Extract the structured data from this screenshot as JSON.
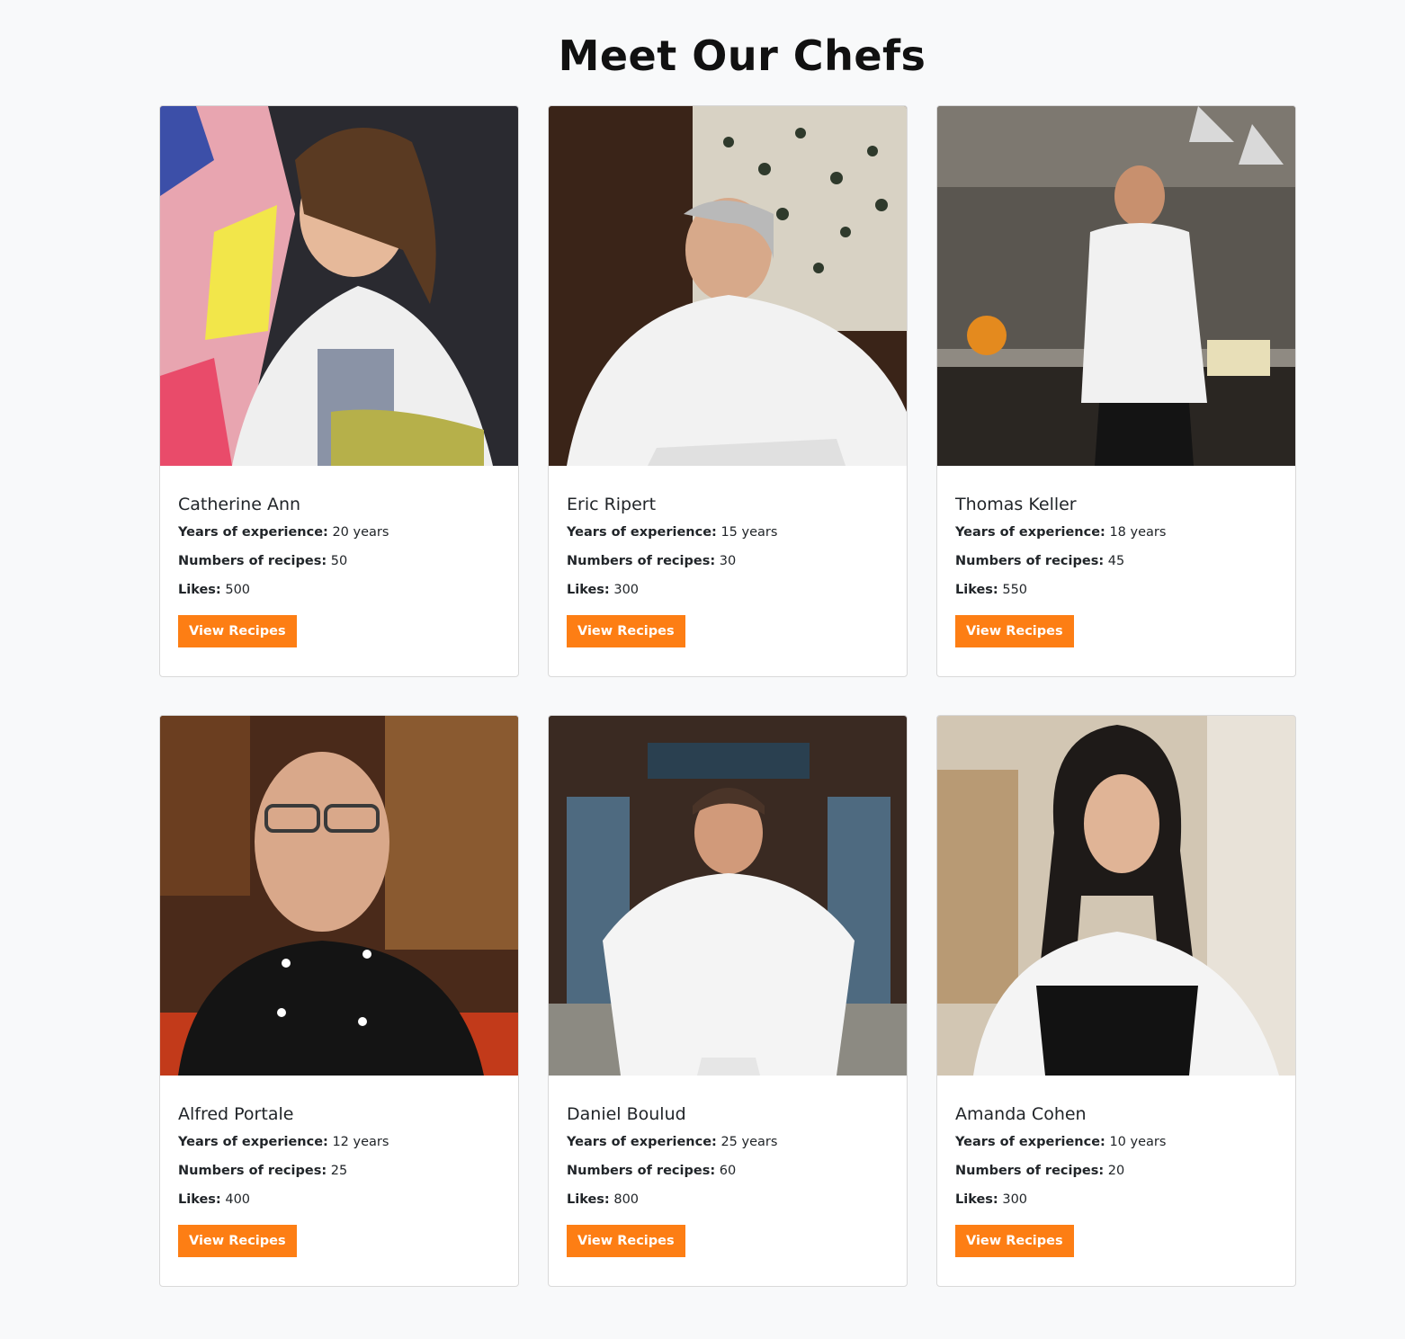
{
  "page": {
    "title": "Meet Our Chefs"
  },
  "labels": {
    "experience": "Years of experience:",
    "recipes": "Numbers of recipes:",
    "likes": "Likes:",
    "button": "View Recipes"
  },
  "colors": {
    "accent": "#fd7e14",
    "background": "#f8f9fa",
    "card": "#ffffff"
  },
  "chefs": [
    {
      "name": "Catherine Ann",
      "experience": "20 years",
      "recipes": "50",
      "likes": "500",
      "photo_icon": "chef-portrait-photo"
    },
    {
      "name": "Eric Ripert",
      "experience": "15 years",
      "recipes": "30",
      "likes": "300",
      "photo_icon": "chef-portrait-photo"
    },
    {
      "name": "Thomas Keller",
      "experience": "18 years",
      "recipes": "45",
      "likes": "550",
      "photo_icon": "chef-portrait-photo"
    },
    {
      "name": "Alfred Portale",
      "experience": "12 years",
      "recipes": "25",
      "likes": "400",
      "photo_icon": "chef-portrait-photo"
    },
    {
      "name": "Daniel Boulud",
      "experience": "25 years",
      "recipes": "60",
      "likes": "800",
      "photo_icon": "chef-portrait-photo"
    },
    {
      "name": "Amanda Cohen",
      "experience": "10 years",
      "recipes": "20",
      "likes": "300",
      "photo_icon": "chef-portrait-photo"
    }
  ]
}
